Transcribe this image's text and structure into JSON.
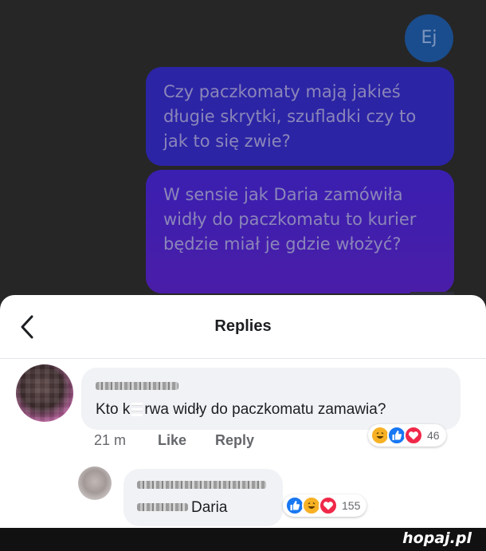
{
  "chat": {
    "messages": [
      {
        "text": "Ej"
      },
      {
        "text": "Czy paczkomaty mają jakieś długie skrytki, szufladki czy to jak to się zwie?"
      },
      {
        "text": "W sensie jak Daria zamówiła widły do paczkomatu to kurier będzie miał je gdzie włożyć?"
      }
    ]
  },
  "replies_sheet": {
    "title": "Replies",
    "back_icon": "chevron-left-icon",
    "comment": {
      "text_part1": "Kto k",
      "text_part2": "rwa widły do paczkomatu zamawia?",
      "time": "21 m",
      "like_label": "Like",
      "reply_label": "Reply",
      "reactions": [
        "haha-icon",
        "like-icon",
        "love-icon"
      ],
      "reaction_count": "46"
    },
    "reply": {
      "text": "Daria",
      "reactions": [
        "like-icon",
        "haha-icon",
        "love-icon"
      ],
      "reaction_count": "155"
    }
  },
  "watermark": "hopaj.pl",
  "colors": {
    "bubble_blue": "#2b24a5",
    "bubble_purple": "#4a1da8",
    "like_blue": "#1877f2",
    "love_red": "#f02849",
    "haha_yellow": "#f7b125"
  }
}
